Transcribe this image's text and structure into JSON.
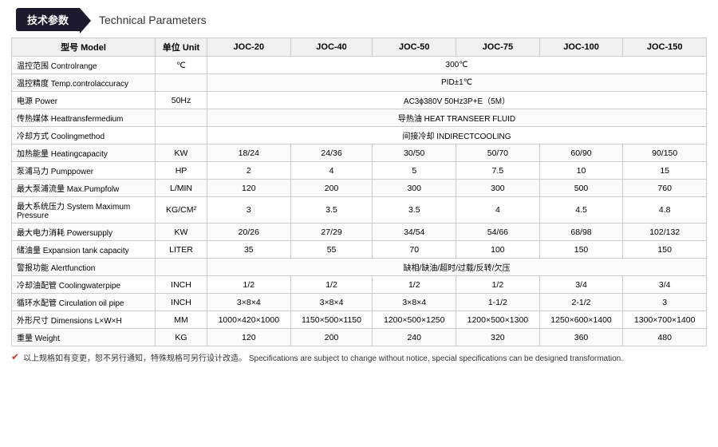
{
  "header": {
    "badge": "技术参数",
    "title": "Technical Parameters"
  },
  "table": {
    "columns": [
      "型号 Model",
      "单位 Unit",
      "JOC-20",
      "JOC-40",
      "JOC-50",
      "JOC-75",
      "JOC-100",
      "JOC-150"
    ],
    "rows": [
      {
        "label": "温控范围 Controlrange",
        "unit": "℃",
        "merged": true,
        "mergedValue": "300℃",
        "values": []
      },
      {
        "label": "温控精度 Temp.controlaccuracy",
        "unit": "",
        "merged": true,
        "mergedValue": "PID±1℃",
        "values": []
      },
      {
        "label": "电源 Power",
        "unit": "50Hz",
        "merged": true,
        "mergedValue": "AC3ϕ380V 50Hz3P+E（5M）",
        "values": []
      },
      {
        "label": "传热媒体 Heattransfermedium",
        "unit": "",
        "merged": true,
        "mergedValue": "导热油 HEAT TRANSEER FLUID",
        "values": []
      },
      {
        "label": "冷却方式 Coolingmethod",
        "unit": "",
        "merged": true,
        "mergedValue": "间接冷却 INDIRECTCOOLING",
        "values": []
      },
      {
        "label": "加热能量 Heatingcapacity",
        "unit": "KW",
        "merged": false,
        "values": [
          "18/24",
          "24/36",
          "30/50",
          "50/70",
          "60/90",
          "90/150"
        ]
      },
      {
        "label": "泵浦马力 Pumppower",
        "unit": "HP",
        "merged": false,
        "values": [
          "2",
          "4",
          "5",
          "7.5",
          "10",
          "15"
        ]
      },
      {
        "label": "最大泵浦流量 Max.Pumpfolw",
        "unit": "L/MIN",
        "merged": false,
        "values": [
          "120",
          "200",
          "300",
          "300",
          "500",
          "760"
        ]
      },
      {
        "label": "最大系统压力 System Maximum Pressure",
        "unit": "KG/CM²",
        "merged": false,
        "values": [
          "3",
          "3.5",
          "3.5",
          "4",
          "4.5",
          "4.8"
        ]
      },
      {
        "label": "最大电力消耗 Powersupply",
        "unit": "KW",
        "merged": false,
        "values": [
          "20/26",
          "27/29",
          "34/54",
          "54/66",
          "68/98",
          "102/132"
        ]
      },
      {
        "label": "储油量 Expansion tank capacity",
        "unit": "LITER",
        "merged": false,
        "values": [
          "35",
          "55",
          "70",
          "100",
          "150",
          "150"
        ]
      },
      {
        "label": "警报功能 Alertfunction",
        "unit": "",
        "merged": true,
        "mergedValue": "缺相/缺油/超时/过载/反转/欠压",
        "values": []
      },
      {
        "label": "冷却油配管 Coolingwaterpipe",
        "unit": "INCH",
        "merged": false,
        "values": [
          "1/2",
          "1/2",
          "1/2",
          "1/2",
          "3/4",
          "3/4"
        ]
      },
      {
        "label": "循环水配管 Circulation oil pipe",
        "unit": "INCH",
        "merged": false,
        "values": [
          "3×8×4",
          "3×8×4",
          "3×8×4",
          "1-1/2",
          "2-1/2",
          "3"
        ]
      },
      {
        "label": "外形尺寸 Dimensions L×W×H",
        "unit": "MM",
        "merged": false,
        "values": [
          "1000×420×1000",
          "1150×500×1150",
          "1200×500×1250",
          "1200×500×1300",
          "1250×600×1400",
          "1300×700×1400"
        ]
      },
      {
        "label": "重量 Weight",
        "unit": "KG",
        "merged": false,
        "values": [
          "120",
          "200",
          "240",
          "320",
          "360",
          "480"
        ]
      }
    ]
  },
  "footer": {
    "icon": "✔",
    "text": "以上规格如有变更，恕不另行通知，特殊规格可另行设计改造。  Specifications are subject to change without notice, special specifications can be designed transformation."
  }
}
